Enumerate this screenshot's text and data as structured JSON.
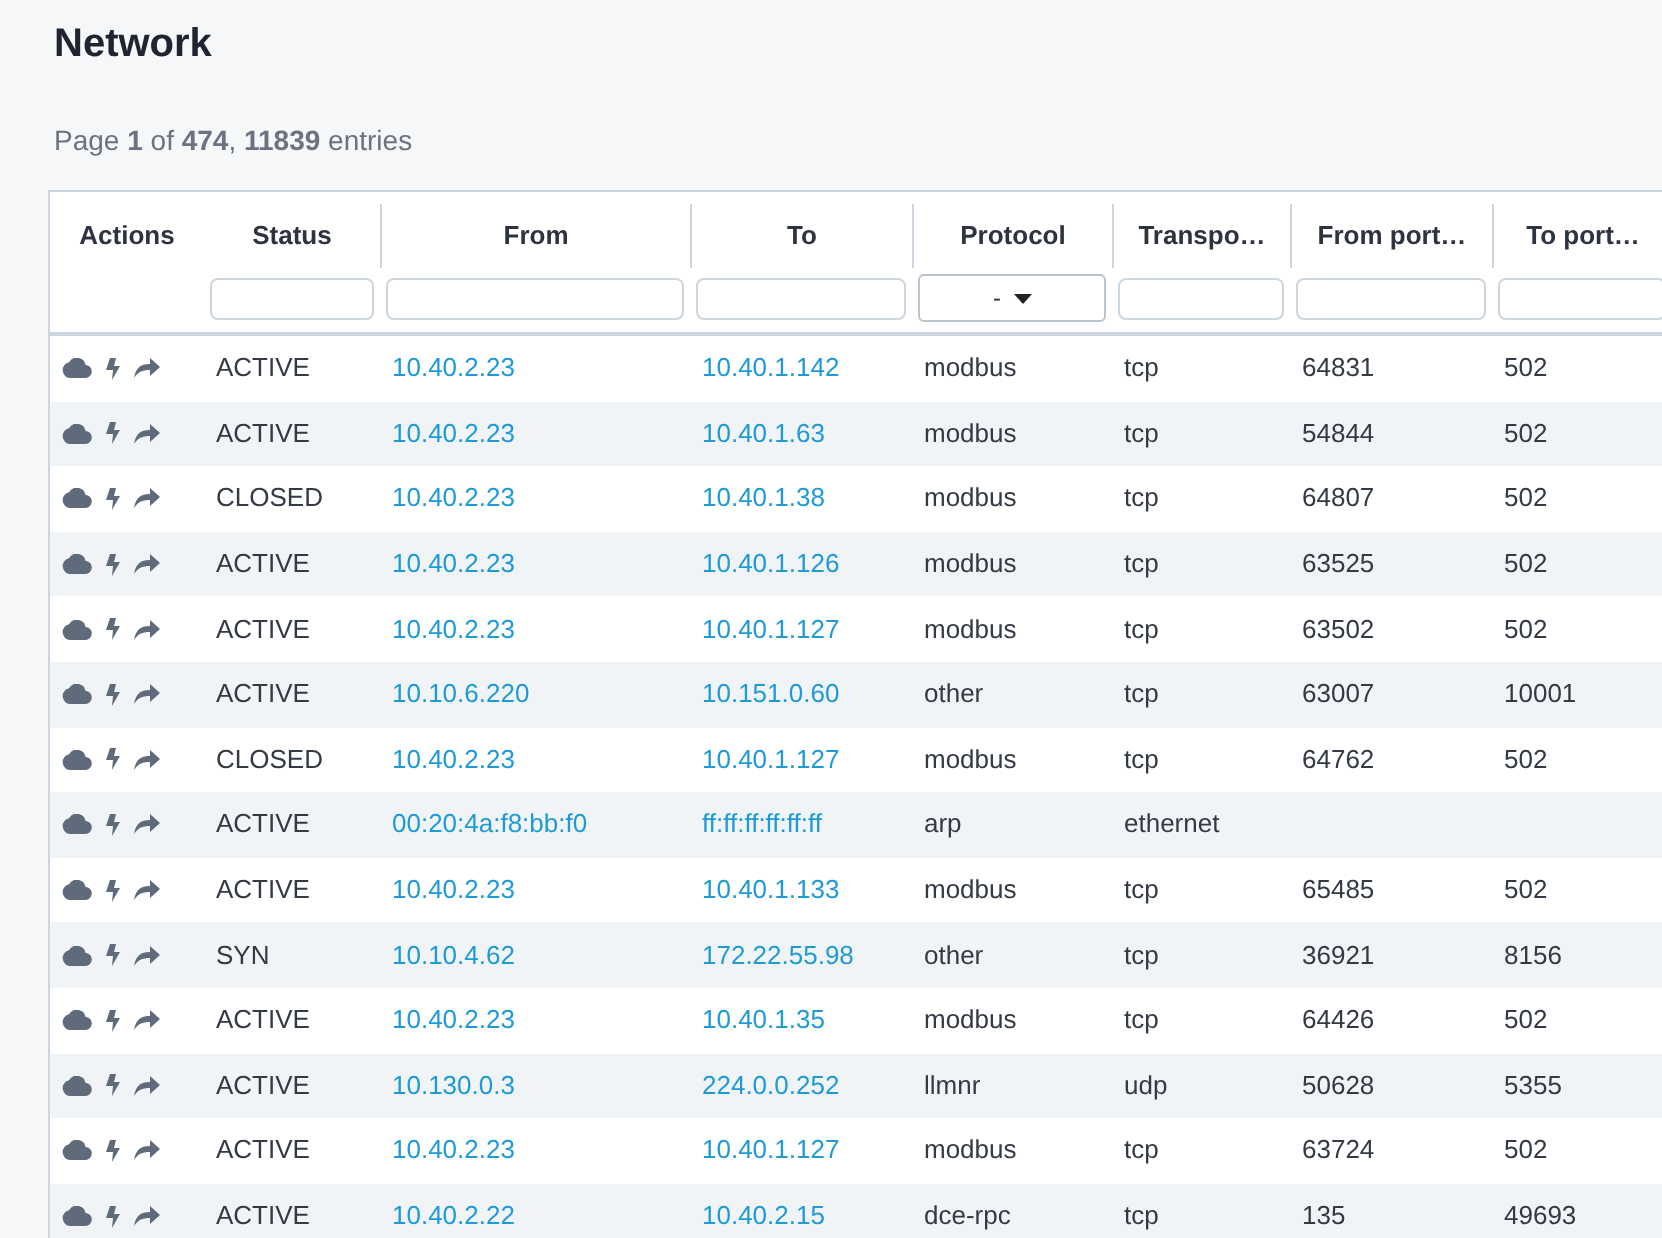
{
  "page_title": "Network",
  "summary": "Page **1** of **474**, **11839** entries",
  "table": {
    "columns": [
      {
        "label": "Actions",
        "kind": "none"
      },
      {
        "label": "Status",
        "kind": "text"
      },
      {
        "label": "From",
        "kind": "text"
      },
      {
        "label": "To",
        "kind": "text"
      },
      {
        "label": "Protocol",
        "kind": "select",
        "value": "-"
      },
      {
        "label": "Transpo…",
        "kind": "text"
      },
      {
        "label": "From port…",
        "kind": "text"
      },
      {
        "label": "To port…",
        "kind": "text"
      }
    ],
    "rows": [
      {
        "status": "ACTIVE",
        "from": "10.40.2.23",
        "to": "10.40.1.142",
        "protocol": "modbus",
        "transport": "tcp",
        "from_port": "64831",
        "to_port": "502"
      },
      {
        "status": "ACTIVE",
        "from": "10.40.2.23",
        "to": "10.40.1.63",
        "protocol": "modbus",
        "transport": "tcp",
        "from_port": "54844",
        "to_port": "502"
      },
      {
        "status": "CLOSED",
        "from": "10.40.2.23",
        "to": "10.40.1.38",
        "protocol": "modbus",
        "transport": "tcp",
        "from_port": "64807",
        "to_port": "502"
      },
      {
        "status": "ACTIVE",
        "from": "10.40.2.23",
        "to": "10.40.1.126",
        "protocol": "modbus",
        "transport": "tcp",
        "from_port": "63525",
        "to_port": "502"
      },
      {
        "status": "ACTIVE",
        "from": "10.40.2.23",
        "to": "10.40.1.127",
        "protocol": "modbus",
        "transport": "tcp",
        "from_port": "63502",
        "to_port": "502"
      },
      {
        "status": "ACTIVE",
        "from": "10.10.6.220",
        "to": "10.151.0.60",
        "protocol": "other",
        "transport": "tcp",
        "from_port": "63007",
        "to_port": "10001"
      },
      {
        "status": "CLOSED",
        "from": "10.40.2.23",
        "to": "10.40.1.127",
        "protocol": "modbus",
        "transport": "tcp",
        "from_port": "64762",
        "to_port": "502"
      },
      {
        "status": "ACTIVE",
        "from": "00:20:4a:f8:bb:f0",
        "to": "ff:ff:ff:ff:ff:ff",
        "protocol": "arp",
        "transport": "ethernet"
      },
      {
        "status": "ACTIVE",
        "from": "10.40.2.23",
        "to": "10.40.1.133",
        "protocol": "modbus",
        "transport": "tcp",
        "from_port": "65485",
        "to_port": "502"
      },
      {
        "status": "SYN",
        "from": "10.10.4.62",
        "to": "172.22.55.98",
        "protocol": "other",
        "transport": "tcp",
        "from_port": "36921",
        "to_port": "8156"
      },
      {
        "status": "ACTIVE",
        "from": "10.40.2.23",
        "to": "10.40.1.35",
        "protocol": "modbus",
        "transport": "tcp",
        "from_port": "64426",
        "to_port": "502"
      },
      {
        "status": "ACTIVE",
        "from": "10.130.0.3",
        "to": "224.0.0.252",
        "protocol": "llmnr",
        "transport": "udp",
        "from_port": "50628",
        "to_port": "5355"
      },
      {
        "status": "ACTIVE",
        "from": "10.40.2.23",
        "to": "10.40.1.127",
        "protocol": "modbus",
        "transport": "tcp",
        "from_port": "63724",
        "to_port": "502"
      },
      {
        "status": "ACTIVE",
        "from": "10.40.2.22",
        "to": "10.40.2.15",
        "protocol": "dce-rpc",
        "transport": "tcp",
        "from_port": "135",
        "to_port": "49693"
      }
    ]
  }
}
